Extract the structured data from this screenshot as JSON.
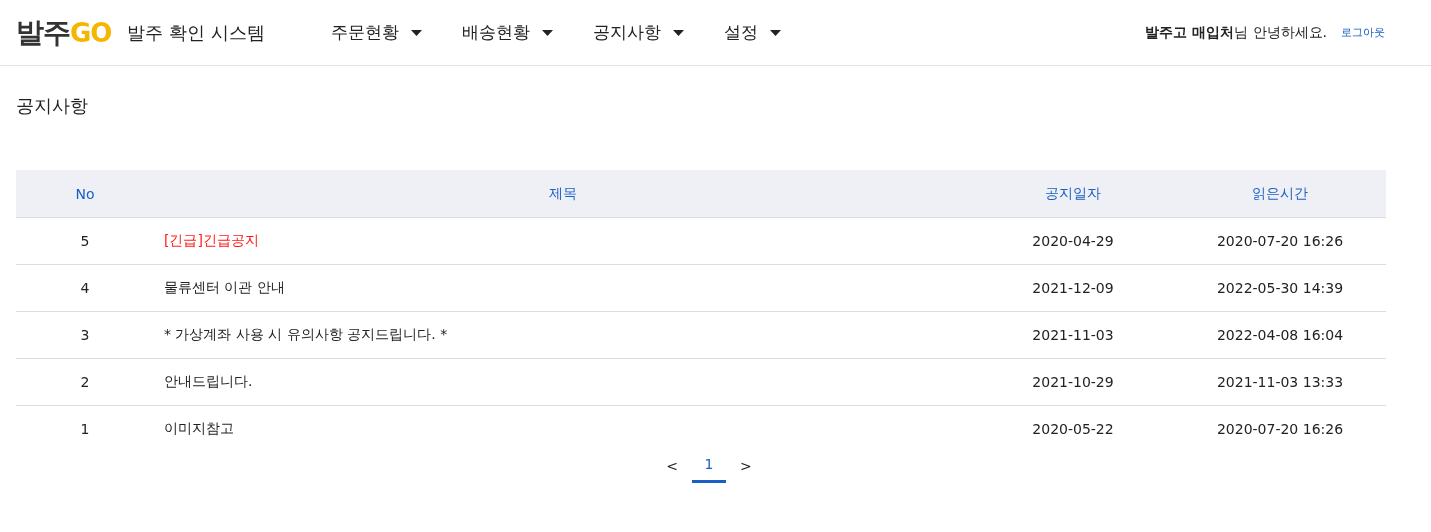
{
  "header": {
    "logo": {
      "main": "발주",
      "accent": "GO"
    },
    "system_title": "발주 확인 시스템",
    "menu": [
      {
        "label": "주문현황"
      },
      {
        "label": "배송현황"
      },
      {
        "label": "공지사항"
      },
      {
        "label": "설정"
      }
    ],
    "greeting": "**발주고 매입처**님 안녕하세요.",
    "logout": "로그아웃"
  },
  "page_title": "공지사항",
  "table": {
    "columns": [
      "No",
      "제목",
      "공지일자",
      "읽은시간"
    ],
    "rows": [
      {
        "no": "5",
        "title": "[긴급]긴급공지",
        "kind": "urgent",
        "date": "2020-04-29",
        "read_time": "2020-07-20 16:26"
      },
      {
        "no": "4",
        "title": "물류센터 이관 안내",
        "kind": "normal",
        "date": "2021-12-09",
        "read_time": "2022-05-30 14:39"
      },
      {
        "no": "3",
        "title": "* 가상계좌 사용 시 유의사항 공지드립니다. *",
        "kind": "normal",
        "date": "2021-11-03",
        "read_time": "2022-04-08 16:04"
      },
      {
        "no": "2",
        "title": "안내드립니다.",
        "kind": "normal",
        "date": "2021-10-29",
        "read_time": "2021-11-03 13:33"
      },
      {
        "no": "1",
        "title": "이미지참고",
        "kind": "normal",
        "date": "2020-05-22",
        "read_time": "2020-07-20 16:26"
      }
    ]
  },
  "pagination": {
    "prev": "<",
    "pages": [
      {
        "label": "1",
        "selected": true
      }
    ],
    "next": ">"
  }
}
